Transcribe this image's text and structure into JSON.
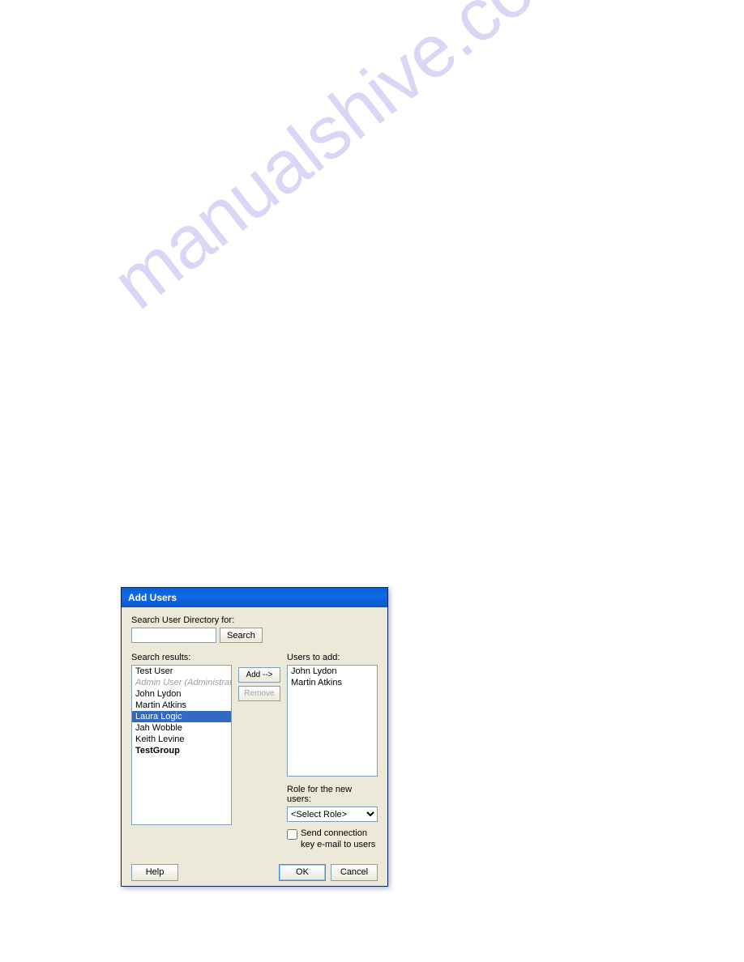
{
  "watermark": "manualshive.com",
  "dialog": {
    "title": "Add Users",
    "search": {
      "label": "Search User Directory for:",
      "value": "",
      "button": "Search"
    },
    "results": {
      "label": "Search results:",
      "items": [
        {
          "text": "Test User",
          "state": "normal"
        },
        {
          "text": "Admin User (Administrator)",
          "state": "disabled"
        },
        {
          "text": "John Lydon",
          "state": "normal"
        },
        {
          "text": "Martin Atkins",
          "state": "normal"
        },
        {
          "text": "Laura Logic",
          "state": "selected"
        },
        {
          "text": "Jah Wobble",
          "state": "normal"
        },
        {
          "text": "Keith Levine",
          "state": "normal"
        },
        {
          "text": "TestGroup",
          "state": "group"
        }
      ]
    },
    "midButtons": {
      "add": "Add -->",
      "remove": "Remove"
    },
    "usersToAdd": {
      "label": "Users to add:",
      "items": [
        {
          "text": "John Lydon"
        },
        {
          "text": "Martin Atkins"
        }
      ]
    },
    "role": {
      "label": "Role for the new users:",
      "selected": "<Select Role>"
    },
    "sendKey": {
      "checked": false,
      "label": "Send connection key e-mail to users"
    },
    "buttons": {
      "help": "Help",
      "ok": "OK",
      "cancel": "Cancel"
    }
  }
}
